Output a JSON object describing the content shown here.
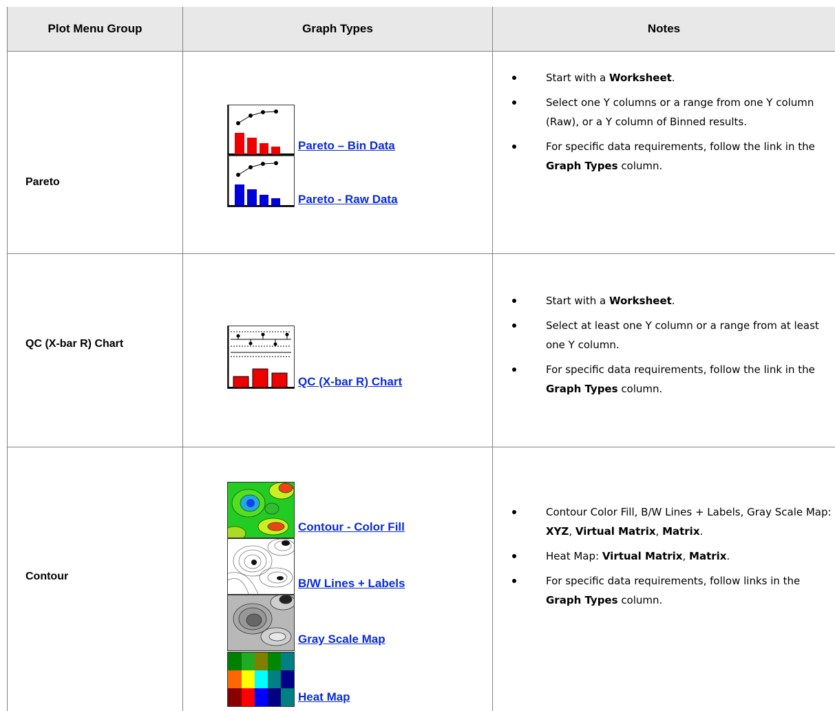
{
  "table": {
    "headers": [
      "Plot Menu Group",
      "Graph Types",
      "Notes"
    ],
    "rows": [
      {
        "group": "Pareto",
        "graph_types": [
          {
            "label": "Pareto – Bin Data",
            "icon": "pareto-red-bars-icon"
          },
          {
            "label": "Pareto - Raw Data",
            "icon": "pareto-blue-bars-icon"
          }
        ],
        "notes": [
          [
            "Start with a ",
            "Worksheet",
            "."
          ],
          [
            "Select one Y columns or a range from one Y column (Raw), or a Y column of Binned results."
          ],
          [
            "For specific data requirements, follow the link in the ",
            "Graph Types",
            " column."
          ]
        ]
      },
      {
        "group": "QC (X-bar R) Chart",
        "graph_types": [
          {
            "label": "QC (X-bar R) Chart",
            "icon": "qc-chart-icon"
          }
        ],
        "notes": [
          [
            "Start with a ",
            "Worksheet",
            "."
          ],
          [
            "Select at least one Y column or a range from at least one Y column."
          ],
          [
            "For specific data requirements, follow the link in the ",
            "Graph Types",
            " column."
          ]
        ]
      },
      {
        "group": "Contour",
        "graph_types": [
          {
            "label": "Contour - Color Fill",
            "icon": "contour-color-fill-icon"
          },
          {
            "label": "B/W Lines + Labels",
            "icon": "contour-bw-lines-icon"
          },
          {
            "label": "Gray Scale Map",
            "icon": "gray-scale-map-icon"
          },
          {
            "label": "Heat Map",
            "icon": "heat-map-icon"
          }
        ],
        "notes": [
          [
            "Contour Color Fill, B/W Lines + Labels, Gray Scale Map: ",
            "XYZ",
            ", ",
            "Virtual Matrix",
            ", ",
            "Matrix",
            "."
          ],
          [
            "Heat Map: ",
            "Virtual Matrix",
            ", ",
            "Matrix",
            "."
          ],
          [
            "For specific data requirements, follow links in the ",
            "Graph Types",
            " column."
          ]
        ]
      }
    ]
  },
  "colors": {
    "link": "#0a2bd6",
    "header_bg": "#e8e8e8",
    "border": "#808080",
    "pareto_red": "#ee0000",
    "pareto_blue": "#0000dd"
  }
}
